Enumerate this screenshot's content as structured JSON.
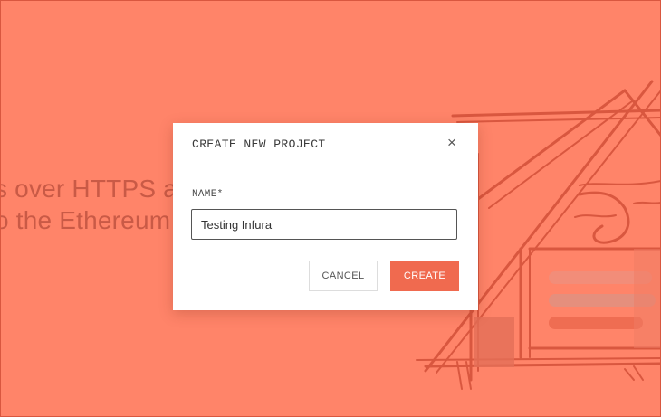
{
  "background": {
    "line1": "s over HTTPS a",
    "line2": "o the Ethereum"
  },
  "modal": {
    "title": "CREATE NEW PROJECT",
    "close_icon": "×",
    "field_label": "NAME*",
    "name_value": "Testing Infura",
    "cancel_label": "CANCEL",
    "create_label": "CREATE"
  },
  "colors": {
    "page_background": "#ff8469",
    "accent": "#f06a4f",
    "illustration": "#d9573f"
  }
}
